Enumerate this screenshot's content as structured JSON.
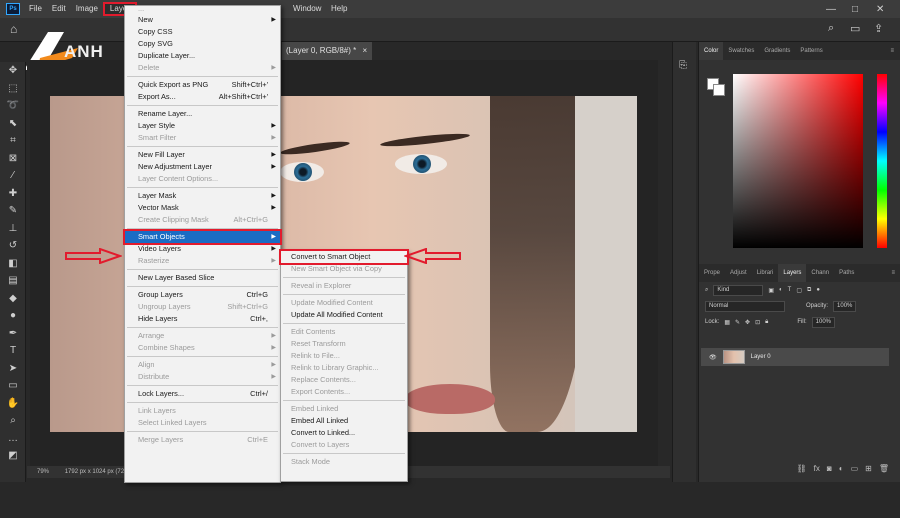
{
  "menubar": {
    "logo": "Ps",
    "items": [
      "File",
      "Edit",
      "Image",
      "Layer",
      "Type",
      "Select",
      "Filter",
      "3D",
      "View",
      "Plugins",
      "Window",
      "Help"
    ],
    "active": "Layer",
    "window_label": "Window",
    "help_label": "Help"
  },
  "brand": {
    "text": "ANH"
  },
  "document": {
    "tab_title": "(Layer 0, RGB/8#) *",
    "close": "×",
    "status_zoom": "79%",
    "status_info": "1792 px x 1024 px (72 ppi)"
  },
  "layer_menu": {
    "top_partial": "...",
    "items": [
      {
        "label": "New",
        "shortcut": "",
        "arrow": true,
        "disabled": false
      },
      {
        "label": "Copy CSS",
        "shortcut": "",
        "arrow": false,
        "disabled": false
      },
      {
        "label": "Copy SVG",
        "shortcut": "",
        "arrow": false,
        "disabled": false
      },
      {
        "label": "Duplicate Layer...",
        "shortcut": "",
        "arrow": false,
        "disabled": false
      },
      {
        "label": "Delete",
        "shortcut": "",
        "arrow": true,
        "disabled": true
      },
      {
        "sep": true
      },
      {
        "label": "Quick Export as PNG",
        "shortcut": "Shift+Ctrl+'",
        "arrow": false,
        "disabled": false
      },
      {
        "label": "Export As...",
        "shortcut": "Alt+Shift+Ctrl+'",
        "arrow": false,
        "disabled": false
      },
      {
        "sep": true
      },
      {
        "label": "Rename Layer...",
        "shortcut": "",
        "arrow": false,
        "disabled": false
      },
      {
        "label": "Layer Style",
        "shortcut": "",
        "arrow": true,
        "disabled": false
      },
      {
        "label": "Smart Filter",
        "shortcut": "",
        "arrow": true,
        "disabled": true
      },
      {
        "sep": true
      },
      {
        "label": "New Fill Layer",
        "shortcut": "",
        "arrow": true,
        "disabled": false
      },
      {
        "label": "New Adjustment Layer",
        "shortcut": "",
        "arrow": true,
        "disabled": false
      },
      {
        "label": "Layer Content Options...",
        "shortcut": "",
        "arrow": false,
        "disabled": true
      },
      {
        "sep": true
      },
      {
        "label": "Layer Mask",
        "shortcut": "",
        "arrow": true,
        "disabled": false
      },
      {
        "label": "Vector Mask",
        "shortcut": "",
        "arrow": true,
        "disabled": false
      },
      {
        "label": "Create Clipping Mask",
        "shortcut": "Alt+Ctrl+G",
        "arrow": false,
        "disabled": true
      },
      {
        "sep": true
      },
      {
        "label": "Smart Objects",
        "shortcut": "",
        "arrow": true,
        "disabled": false,
        "highlight": true
      },
      {
        "label": "Video Layers",
        "shortcut": "",
        "arrow": true,
        "disabled": false
      },
      {
        "label": "Rasterize",
        "shortcut": "",
        "arrow": true,
        "disabled": true
      },
      {
        "sep": true
      },
      {
        "label": "New Layer Based Slice",
        "shortcut": "",
        "arrow": false,
        "disabled": false
      },
      {
        "sep": true
      },
      {
        "label": "Group Layers",
        "shortcut": "Ctrl+G",
        "arrow": false,
        "disabled": false
      },
      {
        "label": "Ungroup Layers",
        "shortcut": "Shift+Ctrl+G",
        "arrow": false,
        "disabled": true
      },
      {
        "label": "Hide Layers",
        "shortcut": "Ctrl+,",
        "arrow": false,
        "disabled": false
      },
      {
        "sep": true
      },
      {
        "label": "Arrange",
        "shortcut": "",
        "arrow": true,
        "disabled": true
      },
      {
        "label": "Combine Shapes",
        "shortcut": "",
        "arrow": true,
        "disabled": true
      },
      {
        "sep": true
      },
      {
        "label": "Align",
        "shortcut": "",
        "arrow": true,
        "disabled": true
      },
      {
        "label": "Distribute",
        "shortcut": "",
        "arrow": true,
        "disabled": true
      },
      {
        "sep": true
      },
      {
        "label": "Lock Layers...",
        "shortcut": "Ctrl+/",
        "arrow": false,
        "disabled": false
      },
      {
        "sep": true
      },
      {
        "label": "Link Layers",
        "shortcut": "",
        "arrow": false,
        "disabled": true
      },
      {
        "label": "Select Linked Layers",
        "shortcut": "",
        "arrow": false,
        "disabled": true
      },
      {
        "sep": true
      },
      {
        "label": "Merge Layers",
        "shortcut": "Ctrl+E",
        "arrow": false,
        "disabled": true
      }
    ]
  },
  "smart_menu": {
    "items": [
      {
        "label": "Convert to Smart Object",
        "disabled": false,
        "boxed": true
      },
      {
        "label": "New Smart Object via Copy",
        "disabled": true
      },
      {
        "sep": true
      },
      {
        "label": "Reveal in Explorer",
        "disabled": true
      },
      {
        "sep": true
      },
      {
        "label": "Update Modified Content",
        "disabled": true
      },
      {
        "label": "Update All Modified Content",
        "disabled": false
      },
      {
        "sep": true
      },
      {
        "label": "Edit Contents",
        "disabled": true
      },
      {
        "label": "Reset Transform",
        "disabled": true
      },
      {
        "label": "Relink to File...",
        "disabled": true
      },
      {
        "label": "Relink to Library Graphic...",
        "disabled": true
      },
      {
        "label": "Replace Contents...",
        "disabled": true
      },
      {
        "label": "Export Contents...",
        "disabled": true
      },
      {
        "sep": true
      },
      {
        "label": "Embed Linked",
        "disabled": true
      },
      {
        "label": "Embed All Linked",
        "disabled": false
      },
      {
        "label": "Convert to Linked...",
        "disabled": false
      },
      {
        "label": "Convert to Layers",
        "disabled": true
      },
      {
        "sep": true
      },
      {
        "label": "Stack Mode",
        "disabled": true
      }
    ]
  },
  "color_panel": {
    "tabs": [
      "Color",
      "Swatches",
      "Gradients",
      "Patterns"
    ],
    "active": "Color"
  },
  "layers_panel": {
    "tabs": [
      "Prope",
      "Adjust",
      "Librari",
      "Layers",
      "Chann",
      "Paths"
    ],
    "active": "Layers",
    "kind_filter": "Kind",
    "blend_mode": "Normal",
    "opacity_label": "Opacity:",
    "opacity_value": "100%",
    "lock_label": "Lock:",
    "fill_label": "Fill:",
    "fill_value": "100%",
    "layer_name": "Layer 0"
  },
  "colors": {
    "highlight": "#1a6cc4",
    "callout_red": "#e21b2d"
  }
}
